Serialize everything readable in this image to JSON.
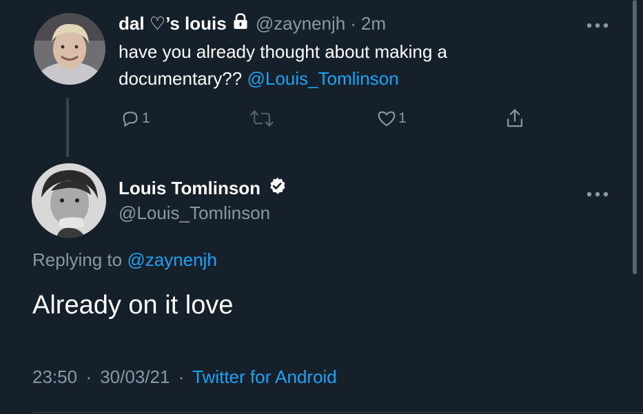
{
  "reply_tweet": {
    "display_name": "dal ♡’s louis",
    "handle": "@zaynenjh",
    "separator": "·",
    "time": "2m",
    "text_before": "have you already thought about making a documentary??",
    "mention": "@Louis_Tomlinson",
    "reply_count": "1",
    "like_count": "1"
  },
  "main_tweet": {
    "display_name": "Louis Tomlinson",
    "handle": "@Louis_Tomlinson",
    "replying_prefix": "Replying to",
    "replying_to": "@zaynenjh",
    "text": "Already on it love",
    "time": "23:50",
    "separator": "·",
    "date": "30/03/21",
    "separator2": "·",
    "source": "Twitter for Android"
  },
  "colors": {
    "background": "#15202b",
    "accent": "#1da1f2",
    "muted": "#8899a6",
    "divider": "#38444d"
  },
  "icons": {
    "lock": "lock-icon",
    "verified": "verified-badge-icon",
    "reply": "comment-icon",
    "retweet": "retweet-icon",
    "like": "heart-icon",
    "share": "share-icon",
    "more": "more-options-icon"
  }
}
